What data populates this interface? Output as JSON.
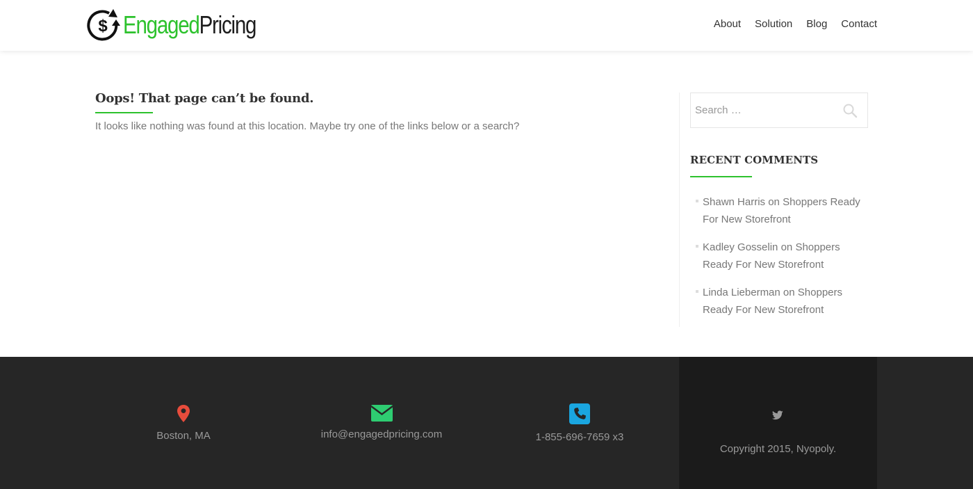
{
  "header": {
    "logo": {
      "text_part1": "Engaged",
      "text_part2": "Pricing",
      "icon": "dollar-cycle-icon"
    },
    "nav": [
      {
        "label": "About"
      },
      {
        "label": "Solution"
      },
      {
        "label": "Blog"
      },
      {
        "label": "Contact"
      }
    ]
  },
  "main": {
    "title": "Oops! That page can’t be found.",
    "message": "It looks like nothing was found at this location. Maybe try one of the links below or a search?"
  },
  "sidebar": {
    "search": {
      "placeholder": "Search …",
      "icon": "search-icon"
    },
    "recent_comments": {
      "title": "RECENT COMMENTS",
      "items": [
        {
          "author": "Shawn Harris",
          "connector": " on ",
          "post": "Shoppers Ready For New Storefront"
        },
        {
          "author": "Kadley Gosselin",
          "connector": " on ",
          "post": "Shoppers Ready For New Storefront"
        },
        {
          "author": "Linda Lieberman",
          "connector": " on ",
          "post": "Shoppers Ready For New Storefront"
        }
      ]
    }
  },
  "footer": {
    "location": {
      "text": "Boston, MA",
      "icon": "map-pin-icon",
      "color": "#e74c3c"
    },
    "email": {
      "text": "info@engagedpricing.com",
      "icon": "envelope-icon",
      "color": "#2ecc71"
    },
    "phone": {
      "text": "1-855-696-7659 x3",
      "icon": "phone-icon",
      "color": "#1aa6e0"
    },
    "social": {
      "icon": "twitter-icon"
    },
    "copyright": "Copyright 2015, Nyopoly."
  },
  "colors": {
    "accent": "#2dc22d",
    "footer_bg": "#262626",
    "footer_dark_bg": "#1b1b1b"
  }
}
